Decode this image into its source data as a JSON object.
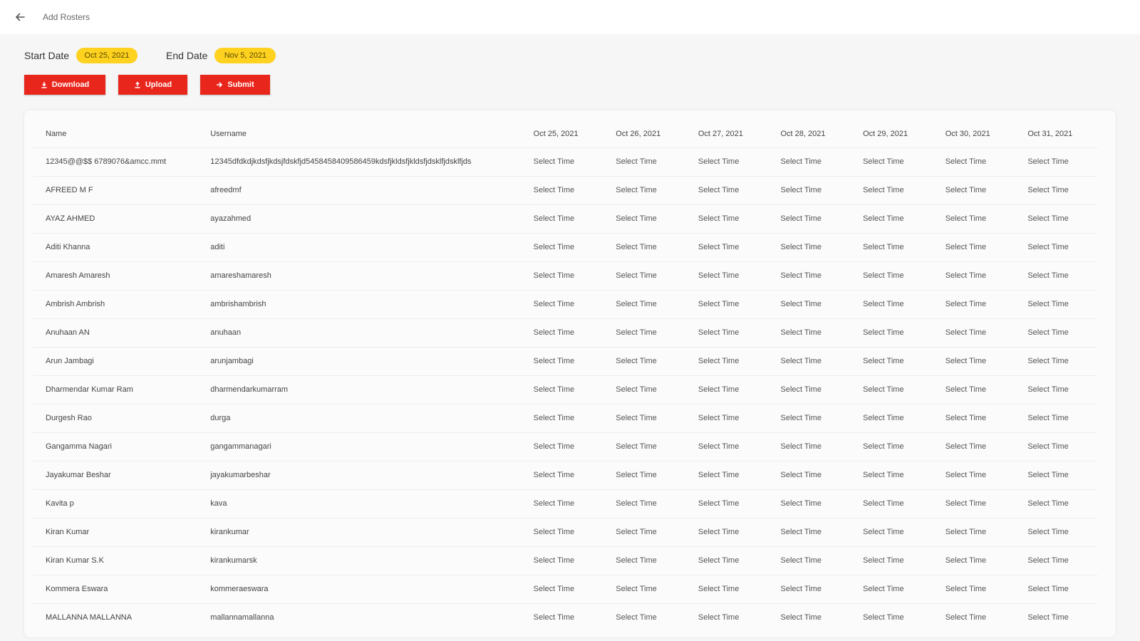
{
  "header": {
    "title": "Add Rosters"
  },
  "dates": {
    "start_label": "Start Date",
    "start_value": "Oct 25, 2021",
    "end_label": "End Date",
    "end_value": "Nov 5, 2021"
  },
  "actions": {
    "download": "Download",
    "upload": "Upload",
    "submit": "Submit"
  },
  "colors": {
    "accent": "#e8261c",
    "chip": "#ffd21f"
  },
  "table": {
    "columns": [
      "Name",
      "Username",
      "Oct 25, 2021",
      "Oct 26, 2021",
      "Oct 27, 2021",
      "Oct 28, 2021",
      "Oct 29, 2021",
      "Oct 30, 2021",
      "Oct 31, 2021"
    ],
    "cell_placeholder": "Select Time",
    "rows": [
      {
        "name": "12345@@$$ 6789076&amcc.mmt",
        "username": "12345dfdkdjkdsfjkdsjfdskfjd5458458409586459kdsfjkldsfjkldsfjdsklfjdsklfjds"
      },
      {
        "name": "AFREED M F",
        "username": "afreedmf"
      },
      {
        "name": "AYAZ AHMED",
        "username": "ayazahmed"
      },
      {
        "name": "Aditi Khanna",
        "username": "aditi"
      },
      {
        "name": "Amaresh Amaresh",
        "username": "amareshamaresh"
      },
      {
        "name": "Ambrish Ambrish",
        "username": "ambrishambrish"
      },
      {
        "name": "Anuhaan AN",
        "username": "anuhaan"
      },
      {
        "name": "Arun Jambagi",
        "username": "arunjambagi"
      },
      {
        "name": "Dharmendar Kumar Ram",
        "username": "dharmendarkumarram"
      },
      {
        "name": "Durgesh Rao",
        "username": "durga"
      },
      {
        "name": "Gangamma Nagari",
        "username": "gangammanagari"
      },
      {
        "name": "Jayakumar Beshar",
        "username": "jayakumarbeshar"
      },
      {
        "name": "Kavita p",
        "username": "kava"
      },
      {
        "name": "Kiran Kumar",
        "username": "kirankumar"
      },
      {
        "name": "Kiran Kumar S.K",
        "username": "kirankumarsk"
      },
      {
        "name": "Kommera Eswara",
        "username": "kommeraeswara"
      },
      {
        "name": "MALLANNA MALLANNA",
        "username": "mallannamallanna"
      }
    ]
  }
}
